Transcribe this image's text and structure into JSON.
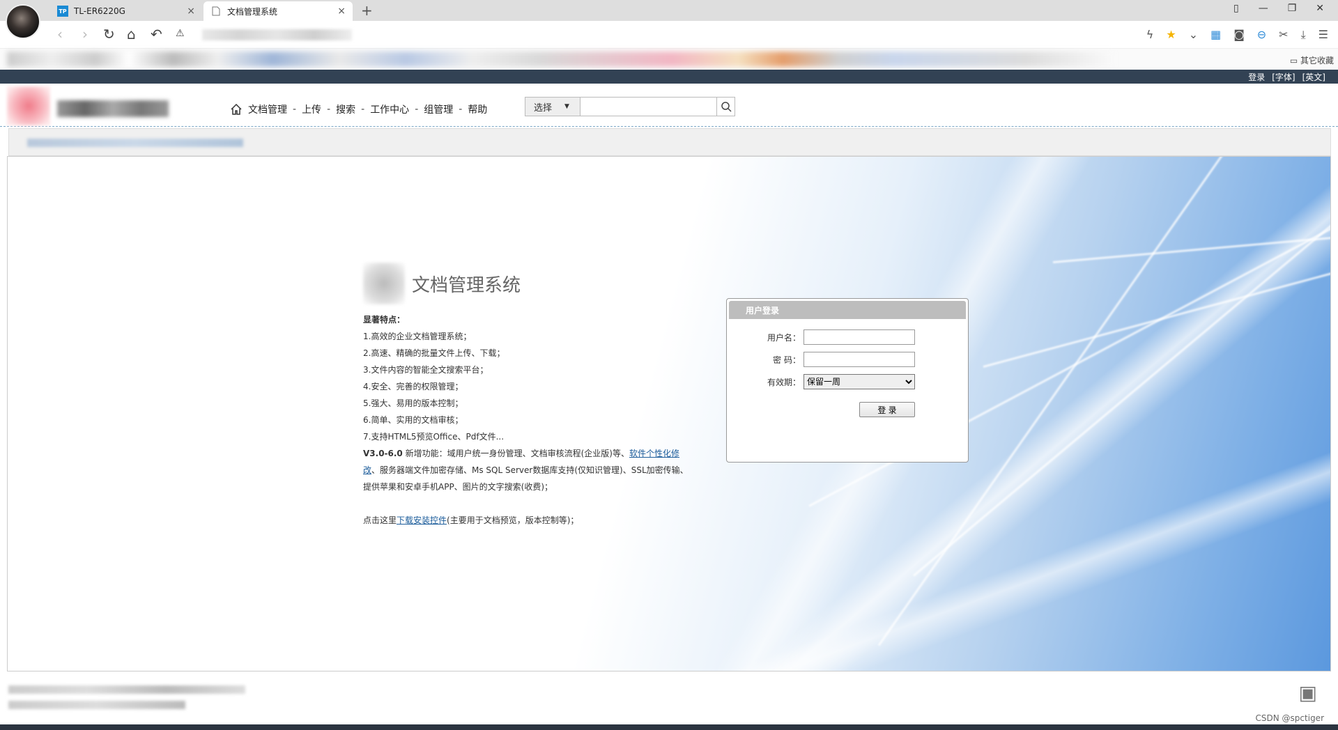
{
  "browser": {
    "tabs": [
      {
        "label": "TL-ER6220G",
        "favicon": "TP"
      },
      {
        "label": "文档管理系统",
        "active": true
      }
    ],
    "new_tab": "+",
    "close": "×",
    "bookmarks_other": "其它收藏"
  },
  "site": {
    "top_links": [
      "登录",
      "[字体]",
      "[英文]"
    ],
    "nav": [
      "文档管理",
      "上传",
      "搜索",
      "工作中心",
      "组管理",
      "帮助"
    ],
    "nav_sep": "-",
    "search_select": "选择",
    "intro_title": "文档管理系统",
    "features_heading": "显著特点：",
    "features": [
      "1.高效的企业文档管理系统；",
      "2.高速、精确的批量文件上传、下载；",
      "3.文件内容的智能全文搜索平台；",
      "4.安全、完善的权限管理；",
      "5.强大、易用的版本控制；",
      "6.简单、实用的文档审核；",
      "7.支持HTML5预览Office、Pdf文件..."
    ],
    "version": "V3.0-6.0",
    "version_text": " 新增功能：域用户统一身份管理、文档审核流程(企业版)等、",
    "version_link": "软件个性化修改",
    "version_text2": "、服务器端文件加密存储、Ms SQL Server数据库支持(仅知识管理)、SSL加密传输、提供苹果和安卓手机APP、图片的文字搜索(收费)；",
    "download_prefix": "点击这里",
    "download_link": "下载安装控件",
    "download_suffix": "(主要用于文档预览，版本控制等)；",
    "login": {
      "title": "用户登录",
      "username_label": "用户名：",
      "password_label": "密  码：",
      "expire_label": "有效期：",
      "expire_value": "保留一周",
      "submit": "登 录"
    },
    "watermark": "CSDN @spctiger"
  }
}
